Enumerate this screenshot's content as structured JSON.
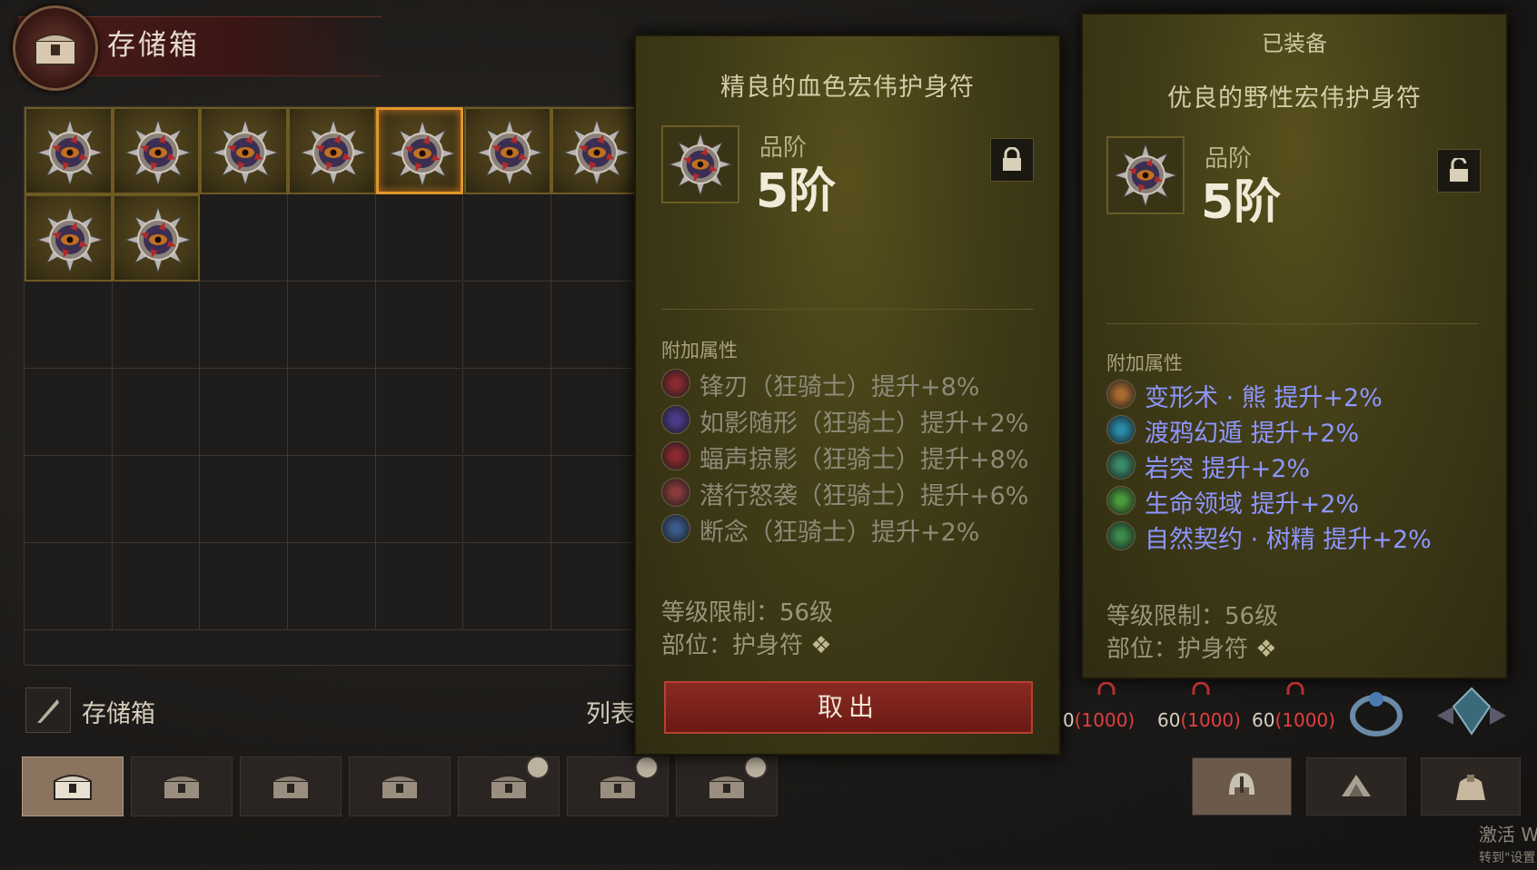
{
  "header": {
    "title": "存储箱"
  },
  "storage": {
    "columns": 7,
    "rows": 6,
    "items": [
      {
        "row": 0,
        "col": 0,
        "selected": false
      },
      {
        "row": 0,
        "col": 1,
        "selected": false
      },
      {
        "row": 0,
        "col": 2,
        "selected": false
      },
      {
        "row": 0,
        "col": 3,
        "selected": false
      },
      {
        "row": 0,
        "col": 4,
        "selected": true
      },
      {
        "row": 0,
        "col": 5,
        "selected": false
      },
      {
        "row": 0,
        "col": 6,
        "selected": false
      },
      {
        "row": 1,
        "col": 0,
        "selected": false
      },
      {
        "row": 1,
        "col": 1,
        "selected": false
      }
    ],
    "footer_label": "存储箱",
    "list_label": "列表"
  },
  "tabs": [
    {
      "icon": "chest-icon",
      "active": true,
      "timer": false
    },
    {
      "icon": "chest-icon",
      "active": false,
      "timer": false
    },
    {
      "icon": "chest-icon",
      "active": false,
      "timer": false
    },
    {
      "icon": "chest-icon",
      "active": false,
      "timer": false
    },
    {
      "icon": "locked-chest-icon",
      "active": false,
      "timer": true
    },
    {
      "icon": "locked-chest-icon",
      "active": false,
      "timer": true
    },
    {
      "icon": "locked-chest-icon",
      "active": false,
      "timer": true
    }
  ],
  "selected_item": {
    "name": "精良的血色宏伟护身符",
    "grade_label": "品阶",
    "grade_value": "5阶",
    "attributes_header": "附加属性",
    "affixes": [
      {
        "text": "锋刃（狂骑士）提升+8%",
        "color": "#8a2a30"
      },
      {
        "text": "如影随形（狂骑士）提升+2%",
        "color": "#4a3a8a"
      },
      {
        "text": "蝠声掠影（狂骑士）提升+8%",
        "color": "#8a2a30"
      },
      {
        "text": "潜行怒袭（狂骑士）提升+6%",
        "color": "#8a3a3a"
      },
      {
        "text": "断念（狂骑士）提升+2%",
        "color": "#3a5a8a"
      }
    ],
    "level_req": "等级限制：56级",
    "slot": "部位：护身符",
    "take_button": "取出"
  },
  "equipped_item": {
    "header": "已装备",
    "name": "优良的野性宏伟护身符",
    "grade_label": "品阶",
    "grade_value": "5阶",
    "attributes_header": "附加属性",
    "affixes": [
      {
        "text": "变形术 · 熊  提升+2%",
        "color": "#a86a30"
      },
      {
        "text": "渡鸦幻遁  提升+2%",
        "color": "#2a8aa8"
      },
      {
        "text": "岩突  提升+2%",
        "color": "#3a8a6a"
      },
      {
        "text": "生命领域  提升+2%",
        "color": "#4a9a3a"
      },
      {
        "text": "自然契约 · 树精  提升+2%",
        "color": "#3a8a4a"
      }
    ],
    "level_req": "等级限制：56级",
    "slot": "部位：护身符"
  },
  "equipment_slots": [
    {
      "level": "0",
      "cap": "(1000)"
    },
    {
      "level": "60",
      "cap": "(1000)"
    },
    {
      "level": "60",
      "cap": "(1000)"
    }
  ],
  "equipment_buttons": [
    {
      "icon": "helmet-icon",
      "active": true
    },
    {
      "icon": "materials-icon",
      "active": false
    },
    {
      "icon": "bag-icon",
      "active": false
    }
  ],
  "watermark": {
    "line1": "激活 W",
    "line2": "转到\"设置"
  },
  "colors": {
    "panel": "#403c17",
    "accent_orange": "#e0962c",
    "affix_blue": "#8e96ff",
    "button_red": "#7a2018"
  }
}
